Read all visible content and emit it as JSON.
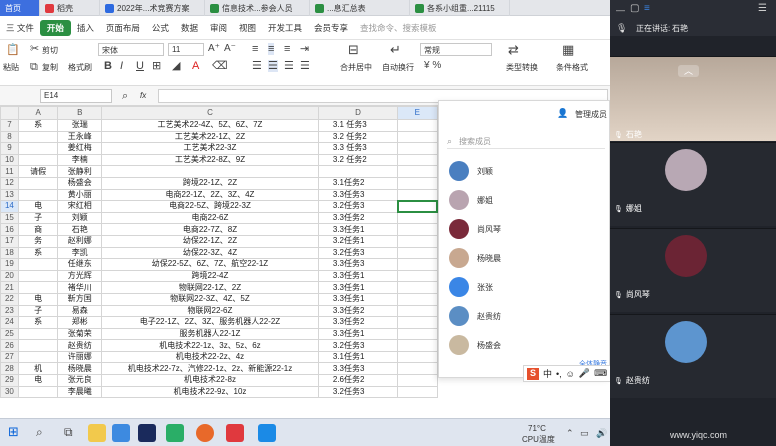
{
  "tabs": [
    {
      "label": "首页",
      "color": "#3d6fdf"
    },
    {
      "label": "稻壳",
      "color": "#e0393e"
    },
    {
      "label": "2022年...术竞赛方案",
      "color": "#2d6ae0"
    },
    {
      "label": "信息技术...参会人员",
      "color": "#2b8f42"
    },
    {
      "label": "...息汇总表",
      "color": "#2b8f42"
    },
    {
      "label": "各系小组重...21115",
      "color": "#2b8f42"
    }
  ],
  "menu": {
    "file": "三 文件",
    "items": [
      "开始",
      "插入",
      "页面布局",
      "公式",
      "数据",
      "审阅",
      "视图",
      "开发工具",
      "会员专享"
    ],
    "search": "查找命令、搜索模板"
  },
  "toolbar": {
    "cut": "剪切",
    "paste": "粘贴",
    "copy": "复制",
    "format_painter": "格式刷",
    "font": "宋体",
    "font_size": "11",
    "number_format": "常规",
    "merge": "合并居中",
    "wrap": "自动换行",
    "type_convert": "类型转换",
    "cond_format": "条件格式"
  },
  "formula": {
    "cell_ref": "E14",
    "fx": "fx"
  },
  "sheet": {
    "columns": [
      "A",
      "B",
      "C",
      "D",
      "E"
    ],
    "rows": [
      {
        "n": "7",
        "a": "系",
        "b": "张瑞",
        "c": "工艺美术22-4Z、5Z、6Z、7Z",
        "d": "3.1 任务3"
      },
      {
        "n": "8",
        "a": "",
        "b": "王永峰",
        "c": "工艺美术22-1Z、2Z",
        "d": "3.2 任务2"
      },
      {
        "n": "9",
        "a": "",
        "b": "姜红梅",
        "c": "工艺美术22-3Z",
        "d": "3.3 任务3"
      },
      {
        "n": "10",
        "a": "",
        "b": "李楠",
        "c": "工艺美术22-8Z、9Z",
        "d": "3.2 任务2"
      },
      {
        "n": "11",
        "a": "请假",
        "b": "张静利",
        "c": "",
        "d": ""
      },
      {
        "n": "12",
        "a": "",
        "b": "杨盛会",
        "c": "跨境22-1Z、2Z",
        "d": "3.1任务2"
      },
      {
        "n": "13",
        "a": "",
        "b": "黄小丽",
        "c": "电商22-1Z、2Z、3Z、4Z",
        "d": "3.3任务3"
      },
      {
        "n": "14",
        "a": "电",
        "b": "宋红相",
        "c": "电商22-5Z、跨境22-3Z",
        "d": "3.2任务3"
      },
      {
        "n": "15",
        "a": "子",
        "b": "刘颖",
        "c": "电商22-6Z",
        "d": "3.3任务2"
      },
      {
        "n": "16",
        "a": "商",
        "b": "石艳",
        "c": "电商22-7Z、8Z",
        "d": "3.3任务1"
      },
      {
        "n": "17",
        "a": "务",
        "b": "赵利娜",
        "c": "幼保22-1Z、2Z",
        "d": "3.2任务1"
      },
      {
        "n": "18",
        "a": "系",
        "b": "李凯",
        "c": "幼保22-3Z、4Z",
        "d": "3.2任务3"
      },
      {
        "n": "19",
        "a": "",
        "b": "任继东",
        "c": "幼保22-5Z、6Z、7Z、航空22-1Z",
        "d": "3.3任务3"
      },
      {
        "n": "20",
        "a": "",
        "b": "方光辉",
        "c": "跨境22-4Z",
        "d": "3.3任务1"
      },
      {
        "n": "21",
        "a": "",
        "b": "褚华川",
        "c": "物联网22-1Z、2Z",
        "d": "3.3任务1"
      },
      {
        "n": "22",
        "a": "电",
        "b": "靳方国",
        "c": "物联网22-3Z、4Z、5Z",
        "d": "3.3任务1"
      },
      {
        "n": "23",
        "a": "子",
        "b": "易森",
        "c": "物联网22-6Z",
        "d": "3.3任务2"
      },
      {
        "n": "24",
        "a": "系",
        "b": "郑彬",
        "c": "电子22-1Z、2Z、3Z、服务机器人22-2Z",
        "d": "3.3任务2"
      },
      {
        "n": "25",
        "a": "",
        "b": "张菊荣",
        "c": "服务机器人22-1Z",
        "d": "3.3任务1"
      },
      {
        "n": "26",
        "a": "",
        "b": "赵贵纺",
        "c": "机电技术22-1z、3z、5z、6z",
        "d": "3.2任务3"
      },
      {
        "n": "27",
        "a": "",
        "b": "许丽娜",
        "c": "机电技术22-2z、4z",
        "d": "3.1任务1"
      },
      {
        "n": "28",
        "a": "机",
        "b": "杨晓晨",
        "c": "机电技术22-7z、汽修22-1z、2z、新能源22-1z",
        "d": "3.3任务3"
      },
      {
        "n": "29",
        "a": "电",
        "b": "张元良",
        "c": "机电技术22-8z",
        "d": "2.6任务2"
      },
      {
        "n": "30",
        "a": "",
        "b": "李晨曦",
        "c": "机电技术22-9z、10z",
        "d": "3.2任务3"
      }
    ]
  },
  "members_panel": {
    "manage_label": "管理成员",
    "search_placeholder": "搜索成员",
    "members": [
      {
        "name": "刘颖",
        "color": "#4a7fc0"
      },
      {
        "name": "娜姐",
        "color": "#b9a4b0"
      },
      {
        "name": "尚风琴",
        "color": "#7a2a3a"
      },
      {
        "name": "杨晓晨",
        "color": "#c8a890"
      },
      {
        "name": "张张",
        "color": "#3a86e6"
      },
      {
        "name": "赵贵纺",
        "color": "#5b8ec4"
      },
      {
        "name": "杨盛会",
        "color": "#c9b9a0"
      }
    ],
    "mute_all": "全体静音"
  },
  "meeting": {
    "speaking_label": "正在讲话:",
    "speaker": "石艳",
    "tiles": [
      {
        "name": "石艳",
        "color": "#d8c2b0"
      },
      {
        "name": "娜姐",
        "color": "#b8a8b4"
      },
      {
        "name": "尚风琴",
        "color": "#6b2434"
      },
      {
        "name": "赵贵纺",
        "color": "#5d95cf"
      }
    ]
  },
  "taskbar": {
    "weather": "71°C",
    "cpu": "CPU温度",
    "watermark": "www.yiqc.com"
  }
}
